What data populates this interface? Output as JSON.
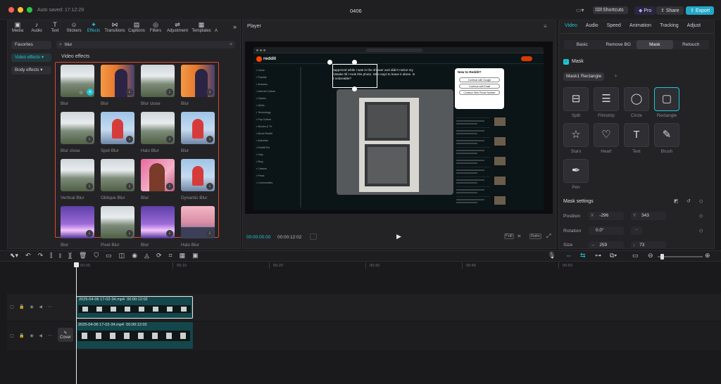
{
  "window": {
    "autosave": "Auto saved: 17:12:29",
    "title": "0406",
    "shortcuts_label": "Shortcuts",
    "pro_label": "Pro",
    "share_label": "Share",
    "export_label": "Export"
  },
  "toolbar_tabs": [
    {
      "label": "Media",
      "icon": "▣"
    },
    {
      "label": "Audio",
      "icon": "♪"
    },
    {
      "label": "Text",
      "icon": "T"
    },
    {
      "label": "Stickers",
      "icon": "☺"
    },
    {
      "label": "Effects",
      "icon": "✦"
    },
    {
      "label": "Transitions",
      "icon": "⋈"
    },
    {
      "label": "Captions",
      "icon": "▤"
    },
    {
      "label": "Filters",
      "icon": "◎"
    },
    {
      "label": "Adjustment",
      "icon": "⇌"
    },
    {
      "label": "Templates",
      "icon": "▦"
    },
    {
      "label": "A",
      "icon": ""
    }
  ],
  "active_tab": "Effects",
  "sidebar": {
    "items": [
      "Favorites",
      "Video effects",
      "Body effects"
    ]
  },
  "search": {
    "value": "blur"
  },
  "effects": {
    "section_title": "Video effects",
    "items": [
      {
        "label": "Blur",
        "style": "mountain"
      },
      {
        "label": "Blur",
        "style": "orange"
      },
      {
        "label": "Blur close",
        "style": "mountain"
      },
      {
        "label": "Blur",
        "style": "orange"
      },
      {
        "label": "Blur close",
        "style": "mountain"
      },
      {
        "label": "Spot Blur",
        "style": "person"
      },
      {
        "label": "Halo Blur",
        "style": "mountain"
      },
      {
        "label": "Blur",
        "style": "person"
      },
      {
        "label": "Vertical Blur",
        "style": "mountain"
      },
      {
        "label": "Oblique Blur",
        "style": "mountain"
      },
      {
        "label": "Blur",
        "style": "pink"
      },
      {
        "label": "Dynamic Blur",
        "style": "person"
      },
      {
        "label": "Blur",
        "style": "purple"
      },
      {
        "label": "Pixel Blur",
        "style": "mountain"
      },
      {
        "label": "Blur",
        "style": "purple"
      },
      {
        "label": "Halo Blur",
        "style": "city"
      }
    ]
  },
  "player": {
    "title": "Player",
    "current_time": "00:00:00:00",
    "total_time": "00:00:12:02",
    "ratio_label": "Ratio",
    "reddit": {
      "logo": "reddit",
      "post_text": "happened while I was in the shower and didn't notice my mistake till I took this photo. Wife says to leave it alone. Is it noticeable?",
      "popup_title": "New to Reddit?",
      "popup_buttons": [
        "Continue with Google",
        "Continue with Email",
        "Continue With Phone Number"
      ],
      "nav": [
        "Home",
        "Popular",
        "Answers",
        "Internet Culture",
        "Games",
        "Q&As",
        "Technology",
        "Pop Culture",
        "Movies & TV",
        "About Reddit",
        "Advertise",
        "Reddit Pro",
        "Help",
        "Blog",
        "Careers",
        "Press",
        "Communities"
      ]
    }
  },
  "inspector": {
    "tabs": [
      "Video",
      "Audio",
      "Speed",
      "Animation",
      "Tracking",
      "Adjust"
    ],
    "subtabs": [
      "Basic",
      "Remove BG",
      "Mask",
      "Retouch"
    ],
    "mask_label": "Mask",
    "mask_chip": "Mask1 Rectangle",
    "shapes": [
      {
        "label": "Split",
        "icon": "split-icon"
      },
      {
        "label": "Filmstrip",
        "icon": "filmstrip-icon"
      },
      {
        "label": "Circle",
        "icon": "circle-icon"
      },
      {
        "label": "Rectangle",
        "icon": "rectangle-icon"
      },
      {
        "label": "Stars",
        "icon": "star-icon"
      },
      {
        "label": "Heart",
        "icon": "heart-icon"
      },
      {
        "label": "Text",
        "icon": "text-icon"
      },
      {
        "label": "Brush",
        "icon": "brush-icon"
      },
      {
        "label": "Pen",
        "icon": "pen-icon"
      }
    ],
    "settings_title": "Mask settings",
    "position_label": "Position",
    "pos_x_label": "X",
    "pos_x": "-296",
    "pos_y_label": "Y",
    "pos_y": "343",
    "rotation_label": "Rotation",
    "rotation": "0.0°",
    "size_label": "Size",
    "size_w": "259",
    "size_h": "73"
  },
  "timeline": {
    "ruler": [
      "00:00",
      "00:10",
      "00:20",
      "00:30",
      "00:40",
      "00:50"
    ],
    "clip1_label": "2025-04-06 17-02-34.mp4",
    "clip1_duration": "00:00:12:02",
    "clip2_label": "2025-04-06 17-02-34.mp4",
    "clip2_duration": "00:00:12:02",
    "cover_label": "Cover"
  },
  "colors": {
    "accent": "#20c5d8",
    "highlight": "#e0462f",
    "export": "#22a9c7"
  }
}
